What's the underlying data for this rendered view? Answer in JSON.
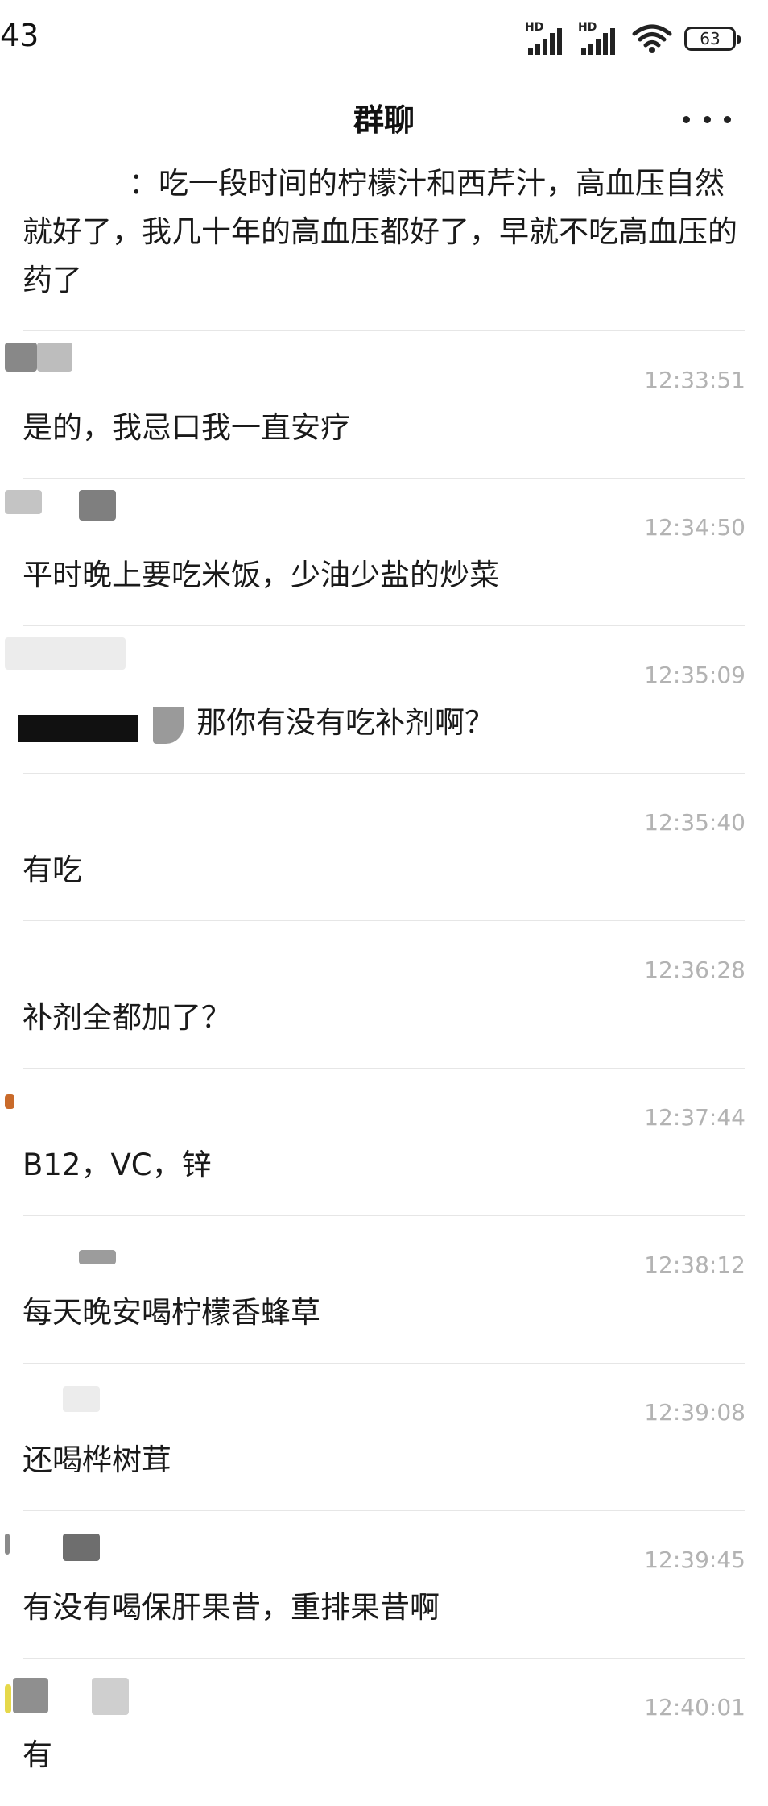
{
  "status_bar": {
    "time": "43",
    "signal_1_label": "HD",
    "signal_2_label": "HD",
    "wifi_icon": "wifi-icon",
    "battery": "63"
  },
  "nav": {
    "title": "群聊",
    "more_icon": "more-icon"
  },
  "messages": [
    {
      "sender": "",
      "time": "",
      "text": "：吃一段时间的柠檬汁和西芹汁，高血压自然就好了，我几十年的高血压都好了，早就不吃高血压的药了"
    },
    {
      "sender": "",
      "time": "12:33:51",
      "text": "是的，我忌口我一直安疗"
    },
    {
      "sender": "",
      "time": "12:34:50",
      "text": "平时晚上要吃米饭，少油少盐的炒菜"
    },
    {
      "sender": "",
      "time": "12:35:09",
      "text": "那你有没有吃补剂啊？"
    },
    {
      "sender": "",
      "time": "12:35:40",
      "text": "有吃"
    },
    {
      "sender": "",
      "time": "12:36:28",
      "text": "补剂全都加了？"
    },
    {
      "sender": "",
      "time": "12:37:44",
      "text": "B12，VC，锌"
    },
    {
      "sender": "",
      "time": "12:38:12",
      "text": "每天晚安喝柠檬香蜂草"
    },
    {
      "sender": "",
      "time": "12:39:08",
      "text": "还喝桦树茸"
    },
    {
      "sender": "",
      "time": "12:39:45",
      "text": "有没有喝保肝果昔，重排果昔啊"
    },
    {
      "sender": "",
      "time": "12:40:01",
      "text": "有"
    }
  ]
}
